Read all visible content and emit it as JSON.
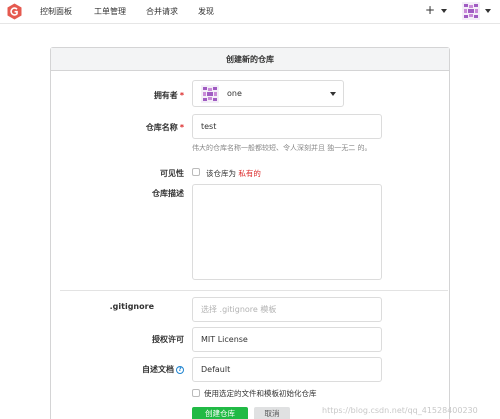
{
  "navbar": {
    "items": [
      {
        "label": "控制面板"
      },
      {
        "label": "工单管理"
      },
      {
        "label": "合并请求"
      },
      {
        "label": "发现"
      }
    ],
    "plus": "+"
  },
  "form": {
    "title": "创建新的仓库",
    "owner": {
      "label": "拥有者",
      "required": "*",
      "value": "one"
    },
    "repo_name": {
      "label": "仓库名称",
      "required": "*",
      "value": "test",
      "help": "伟大的仓库名称一般都较短、令人深刻并且 独一无二 的。"
    },
    "visibility": {
      "label": "可见性",
      "checkbox_text": "该仓库为",
      "private_text": "私有的",
      "checked": false
    },
    "description": {
      "label": "仓库描述",
      "value": ""
    },
    "gitignore": {
      "label": ".gitignore",
      "placeholder": "选择 .gitignore 模板"
    },
    "license": {
      "label": "授权许可",
      "value": "MIT License"
    },
    "readme": {
      "label": "自述文档",
      "help_icon": "?",
      "value": "Default"
    },
    "init": {
      "label": "使用选定的文件和模板初始化仓库",
      "checked": false
    },
    "create_button": "创建仓库",
    "cancel_button": "取消"
  },
  "watermark": "https://blog.csdn.net/qq_41528400230",
  "colors": {
    "accent_green": "#21ba45",
    "required_red": "#db2828",
    "logo_red": "#e55a4f",
    "header_bg": "#f3f4f5"
  }
}
